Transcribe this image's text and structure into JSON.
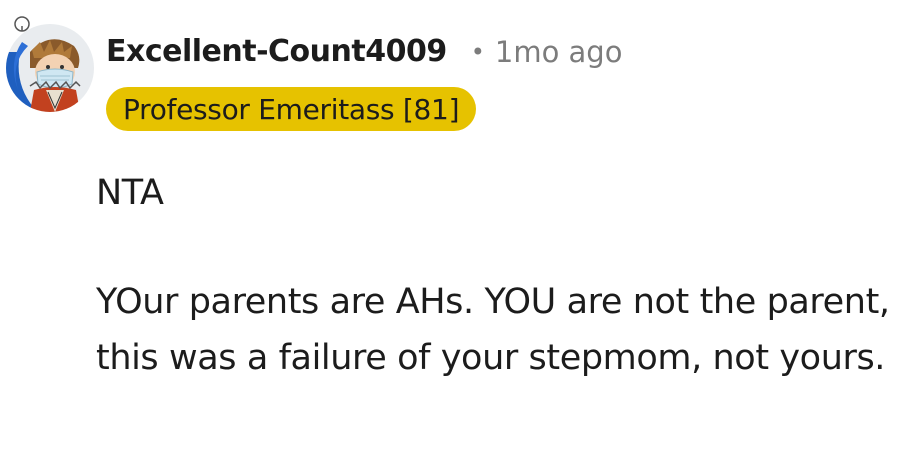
{
  "comment": {
    "username": "Excellent-Count4009",
    "separator": "•",
    "timestamp": "1mo ago",
    "flair": "Professor Emeritass [81]",
    "paragraphs": [
      "NTA",
      "YOur parents are AHs. YOU are not the parent, this was a failure of your stepmom, not yours."
    ]
  },
  "colors": {
    "flair_background": "#e6c200",
    "meta_text": "#7c7c7c",
    "text": "#1c1c1c"
  },
  "icons": {
    "avatar": "snoo-avatar-icon"
  }
}
